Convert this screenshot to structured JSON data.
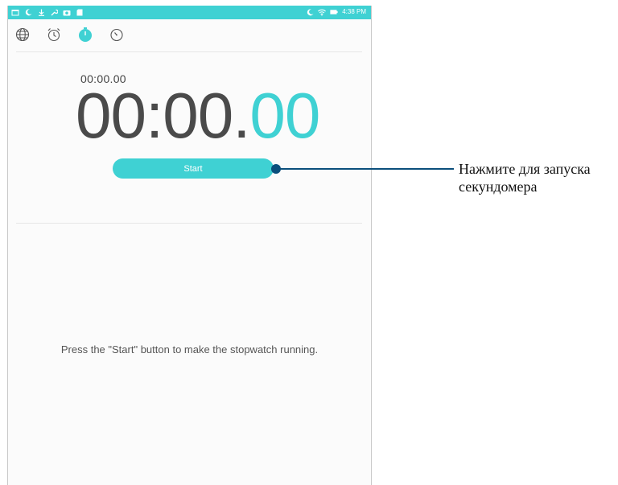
{
  "status_bar": {
    "time": "4:38 PM",
    "color": "#3fd1d3",
    "left_icons": [
      "calendar-icon",
      "moon-icon",
      "download-icon",
      "wrench-icon",
      "camera-icon",
      "sd-card-icon"
    ],
    "right_icons": [
      "moon-icon",
      "wifi-icon",
      "battery-icon"
    ]
  },
  "tabs": [
    {
      "name": "world-clock",
      "icon": "globe-icon",
      "active": false
    },
    {
      "name": "alarm",
      "icon": "alarm-clock-icon",
      "active": false
    },
    {
      "name": "stopwatch",
      "icon": "stopwatch-icon",
      "active": true
    },
    {
      "name": "timer",
      "icon": "timer-icon",
      "active": false
    }
  ],
  "stopwatch": {
    "lap_time": "00:00.00",
    "main_time": "00:00.",
    "centiseconds": "00",
    "start_label": "Start",
    "hint": "Press the \"Start\" button to make the stopwatch running."
  },
  "callout": {
    "text": "Нажмите для запуска секундомера"
  },
  "colors": {
    "accent": "#3fd1d3",
    "callout": "#0b4f7c"
  }
}
